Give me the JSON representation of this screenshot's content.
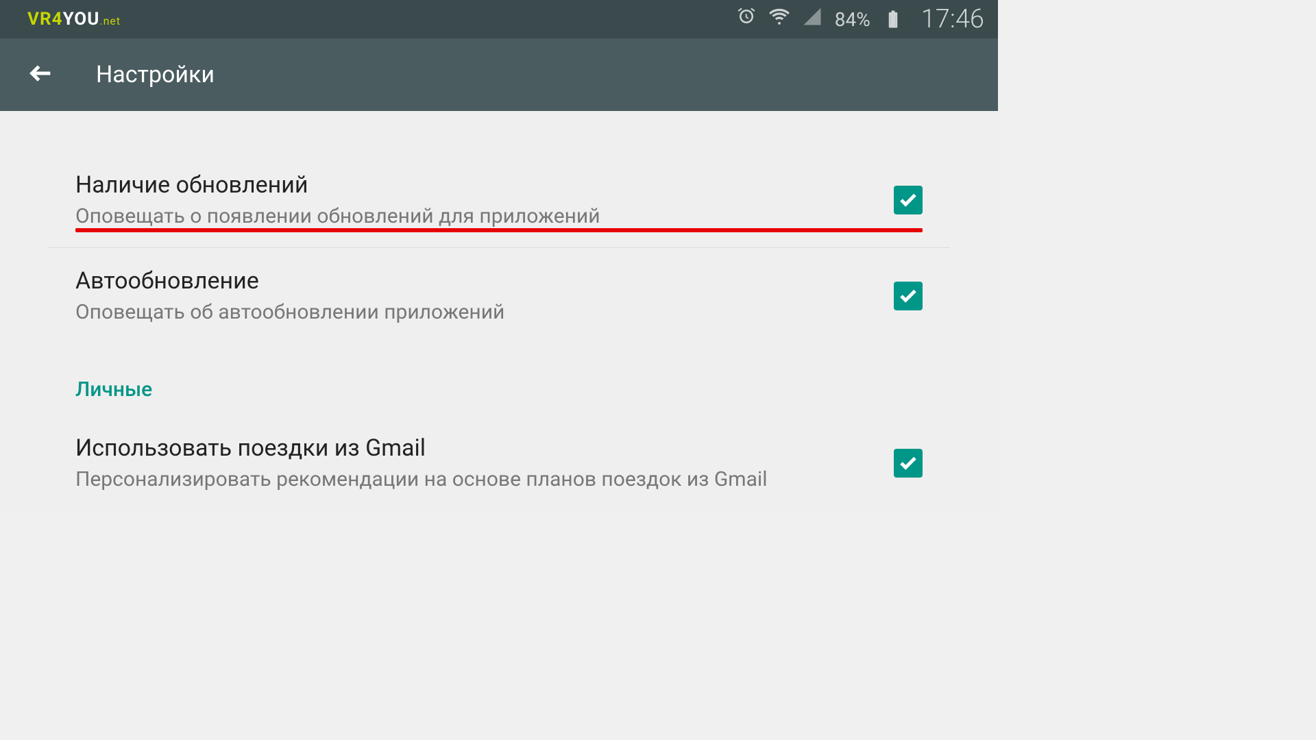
{
  "logo": {
    "vr4": "VR4",
    "you": "YOU",
    "net": ".net"
  },
  "status": {
    "battery_percent": "84%",
    "time": "17:46"
  },
  "appbar": {
    "title": "Настройки"
  },
  "settings": [
    {
      "title": "Наличие обновлений",
      "subtitle": "Оповещать о появлении обновлений для приложений",
      "checked": true,
      "highlighted": true
    },
    {
      "title": "Автообновление",
      "subtitle": "Оповещать об автообновлении приложений",
      "checked": true,
      "highlighted": false
    }
  ],
  "section_header": "Личные",
  "settings2": [
    {
      "title": "Использовать поездки из Gmail",
      "subtitle": "Персонализировать рекомендации на основе планов поездок из Gmail",
      "checked": true
    }
  ]
}
